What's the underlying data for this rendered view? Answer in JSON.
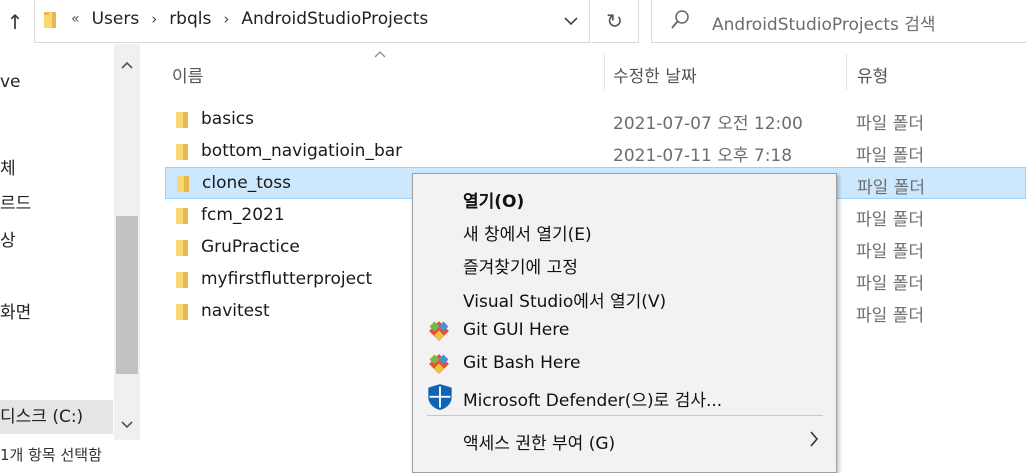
{
  "address": {
    "overflow_symbol": "«",
    "segments": [
      "Users",
      "rbqls",
      "AndroidStudioProjects"
    ],
    "separator": "›",
    "dropdown_symbol": "⌵",
    "up_symbol": "↑",
    "refresh_symbol": "↻"
  },
  "search": {
    "placeholder": "AndroidStudioProjects 검색"
  },
  "nav": {
    "items": [
      "ve",
      "체",
      "르드",
      "상",
      "화면",
      "디스크 (C:)"
    ],
    "selected": "디스크 (C:)",
    "status_partial": "1개 항목 선택함"
  },
  "columns": {
    "name": "이름",
    "date": "수정한 날짜",
    "type": "유형"
  },
  "files": [
    {
      "name": "basics",
      "date": "2021-07-07 오전 12:00",
      "type": "파일 폴더"
    },
    {
      "name": "bottom_navigatioin_bar",
      "date": "2021-07-11 오후 7:18",
      "type": "파일 폴더"
    },
    {
      "name": "clone_toss",
      "date": "",
      "type": "파일 폴더",
      "selected": true
    },
    {
      "name": "fcm_2021",
      "date": "",
      "type": "파일 폴더"
    },
    {
      "name": "GruPractice",
      "date": "",
      "type": "파일 폴더"
    },
    {
      "name": "myfirstflutterproject",
      "date": "",
      "type": "파일 폴더"
    },
    {
      "name": "navitest",
      "date": "",
      "type": "파일 폴더"
    }
  ],
  "context_menu": {
    "items": [
      {
        "label": "열기(O)",
        "bold": true,
        "icon": ""
      },
      {
        "label": "새 창에서 열기(E)",
        "icon": ""
      },
      {
        "label": "즐겨찾기에 고정",
        "icon": ""
      },
      {
        "label": "Visual Studio에서 열기(V)",
        "icon": ""
      },
      {
        "label": "Git GUI Here",
        "icon": "git-icon"
      },
      {
        "label": "Git Bash Here",
        "icon": "git-icon"
      },
      {
        "label": "Microsoft Defender(으)로 검사...",
        "icon": "defender-shield-icon"
      },
      {
        "label": "액세스 권한 부여 (G)",
        "icon": "",
        "submenu": true
      }
    ]
  },
  "colors": {
    "selection_bg": "#cce8ff",
    "selection_border": "#99d1ff",
    "folder_yellow": "#f8d775",
    "menu_bg": "#f2f2f2",
    "defender_blue": "#0e63b8"
  }
}
